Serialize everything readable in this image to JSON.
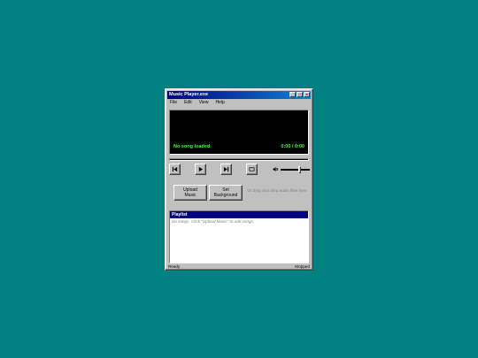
{
  "window": {
    "title": "Music Player.exe",
    "controls": {
      "minimize": "_",
      "maximize": "□",
      "close": "×"
    }
  },
  "menu": [
    "File",
    "Edit",
    "View",
    "Help"
  ],
  "display": {
    "song": "No song loaded",
    "time": "0:00 / 0:00"
  },
  "progress": {
    "fraction": 0
  },
  "controls": {
    "icons": [
      "skip-previous-icon",
      "play-icon",
      "skip-next-icon",
      "repeat-icon"
    ],
    "volume_icon": "speaker-icon",
    "volume_level": 0.65
  },
  "actions": {
    "upload": "Upload Music",
    "background": "Set Background",
    "drop_hint": "Or drag and drop audio files here"
  },
  "playlist": {
    "header": "Playlist",
    "empty": "No songs. Click \"Upload Music\" to add songs."
  },
  "status": {
    "left": "Ready",
    "right": "Stopped"
  },
  "colors": {
    "desktop": "#008080",
    "titlebar": "#000080",
    "display_text": "#33ff33",
    "face": "#c0c0c0"
  }
}
